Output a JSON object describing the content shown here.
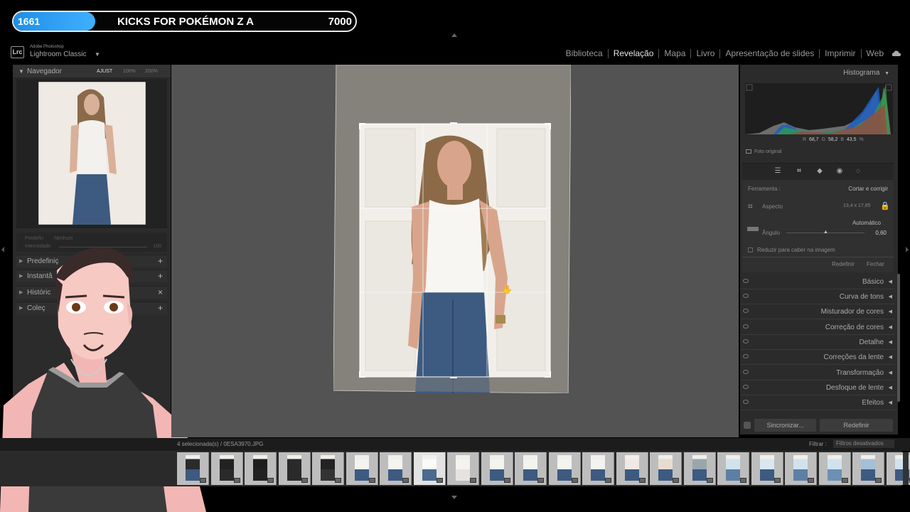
{
  "overlay": {
    "left_num": "1661",
    "title": "KICKS FOR POKÉMON Z A",
    "right_num": "7000",
    "progress_fraction": 0.24
  },
  "app": {
    "vendor": "Adobe Photoshop",
    "name": "Lightroom Classic",
    "logo": "Lrc"
  },
  "modules": [
    "Biblioteca",
    "Revelação",
    "Mapa",
    "Livro",
    "Apresentação de slides",
    "Imprimir",
    "Web"
  ],
  "active_module": "Revelação",
  "left_panel": {
    "navigator": {
      "title": "Navegador",
      "zoom": [
        "AJUST",
        "100%",
        "200%"
      ]
    },
    "preset": {
      "label": "Predefin",
      "value": "Nenhum",
      "intensity_label": "Intensidade",
      "intensity_value": "100"
    },
    "sections": [
      {
        "label": "Predefiniç",
        "action": "+"
      },
      {
        "label": "Instantâ",
        "action": "+"
      },
      {
        "label": "Históric",
        "action": "×"
      },
      {
        "label": "Coleç",
        "action": "+"
      }
    ]
  },
  "right_panel": {
    "histogram_title": "Histograma",
    "histogram_values": {
      "r_label": "R",
      "r": "68,7",
      "g_label": "G",
      "g": "58,2",
      "b_label": "B",
      "b": "43,5",
      "unit": "%"
    },
    "original_photo": "Foto original",
    "crop": {
      "tool_label": "Ferramenta :",
      "tool_value": "Cortar e corrigir",
      "aspect_label": "Aspecto",
      "aspect_value": "13,4 x 17,85",
      "auto_label": "Automático",
      "angle_label": "Ângulo",
      "angle_value": "0,60",
      "constrain_label": "Reduzir para caber na imagem",
      "reset": "Redefinir",
      "close": "Fechar"
    },
    "sections": [
      "Básico",
      "Curva de tons",
      "Misturador de cores",
      "Correção de cores",
      "Detalhe",
      "Correções da lente",
      "Transformação",
      "Desfoque de lente",
      "Efeitos"
    ],
    "sync_button": "Sincronizar...",
    "reset_button": "Redefinir"
  },
  "filmstrip": {
    "info": "4 selecionada(s) / 0ESA3970.JPG",
    "filter_label": "Filtrar :",
    "filter_value": "Filtros desativados"
  }
}
